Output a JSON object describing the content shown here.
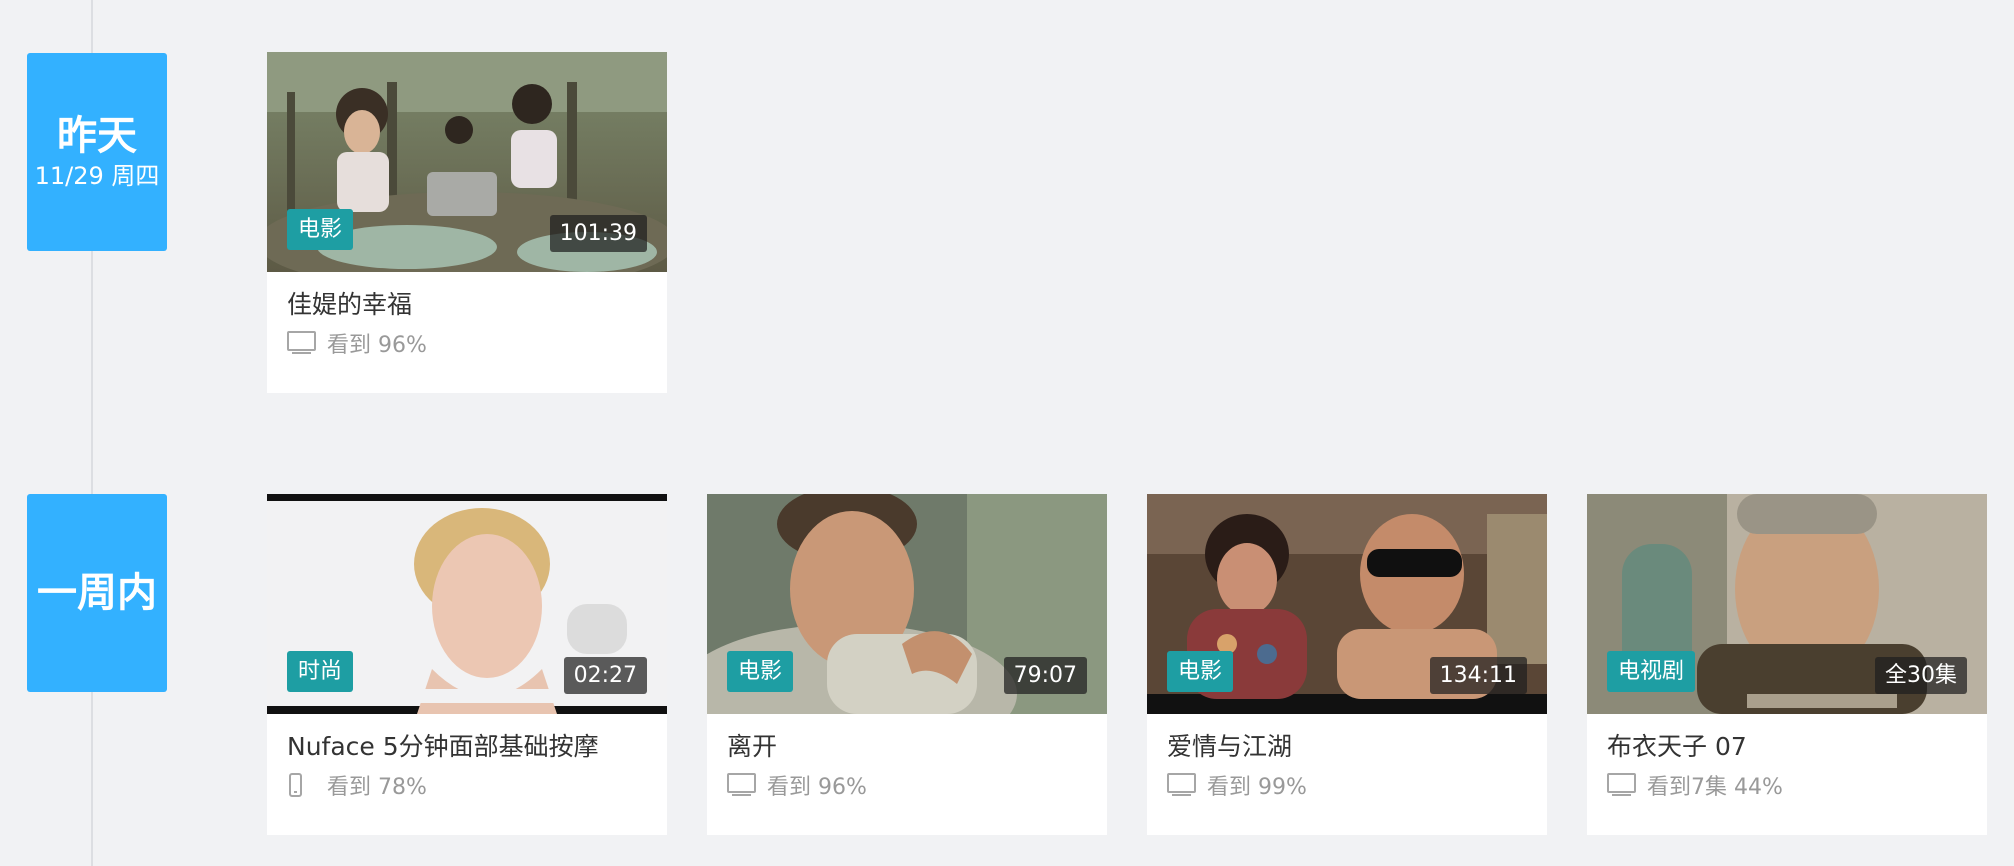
{
  "sections": [
    {
      "title": "昨天",
      "subtitle": "11/29 周四"
    },
    {
      "title": "一周内",
      "subtitle": ""
    }
  ],
  "cards": [
    {
      "title": "佳媞的幸福",
      "category": "电影",
      "duration": "101:39",
      "progress": "看到 96%",
      "device": "tv-icon"
    },
    {
      "title": "Nuface 5分钟面部基础按摩",
      "category": "时尚",
      "duration": "02:27",
      "progress": "看到 78%",
      "device": "phone-icon"
    },
    {
      "title": "离开",
      "category": "电影",
      "duration": "79:07",
      "progress": "看到 96%",
      "device": "tv-icon"
    },
    {
      "title": "爱情与江湖",
      "category": "电影",
      "duration": "134:11",
      "progress": "看到 99%",
      "device": "tv-icon"
    },
    {
      "title": "布衣天子 07",
      "category": "电视剧",
      "duration": "全30集",
      "progress": "看到7集 44%",
      "device": "tv-icon"
    }
  ],
  "colors": {
    "badge": "#33b1ff",
    "category_tag": "#1e9ea3",
    "background": "#f1f2f4"
  }
}
